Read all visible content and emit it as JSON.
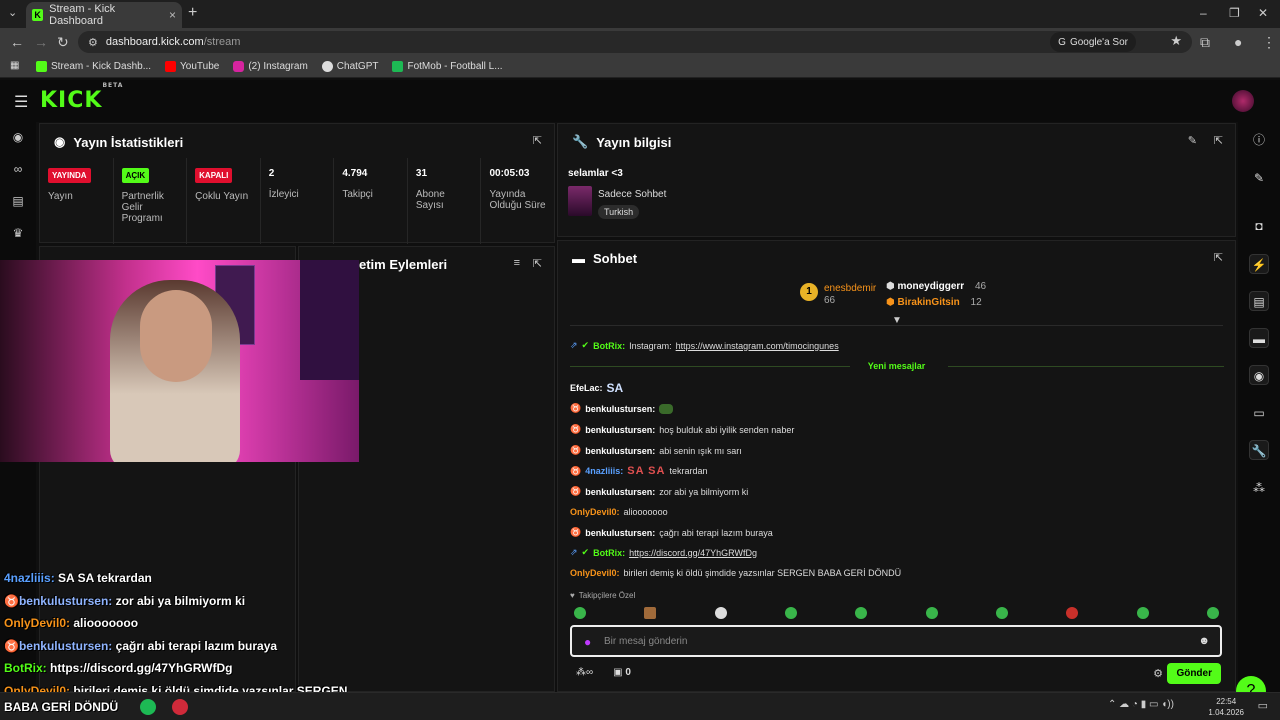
{
  "browser": {
    "tab_title": "Stream - Kick Dashboard",
    "url_host": "dashboard.kick.com",
    "url_path": "/stream",
    "google_label": "Google'a Sor",
    "bookmarks": [
      "Stream - Kick Dashb...",
      "YouTube",
      "(2) Instagram",
      "ChatGPT",
      "FotMob - Football L..."
    ]
  },
  "header": {
    "logo": "KICK",
    "logo_badge": "BETA"
  },
  "stats_panel": {
    "title": "Yayın İstatistikleri",
    "items": [
      {
        "badge": "YAYINDA",
        "label": "Yayın"
      },
      {
        "badge": "AÇIK",
        "label": "Partnerlik Gelir Programı"
      },
      {
        "badge": "KAPALI",
        "label": "Çoklu Yayın"
      },
      {
        "value": "2",
        "label": "İzleyici"
      },
      {
        "value": "4.794",
        "label": "Takipçi"
      },
      {
        "value": "31",
        "label": "Abone Sayısı"
      },
      {
        "value": "00:05:03",
        "label": "Yayında Olduğu Süre"
      }
    ]
  },
  "actions_panel": {
    "title": "etim Eylemleri"
  },
  "info_panel": {
    "title": "Yayın bilgisi",
    "stream_title": "selamlar <3",
    "category": "Sadece Sohbet",
    "tag": "Turkish"
  },
  "chat_panel": {
    "title": "Sohbet",
    "leaders": [
      {
        "rank": "1",
        "name": "enesbdemir",
        "count": "66"
      },
      {
        "name": "moneydiggerr",
        "count": "46"
      },
      {
        "name": "BirakinGitsin",
        "count": "12"
      }
    ],
    "new_messages_label": "Yeni mesajlar",
    "messages": [
      {
        "user": "BotRix:",
        "text": "Instagram:",
        "link": "https://www.instagram.com/timocingunes"
      },
      {
        "user": "EfeLac:",
        "text": "SA"
      },
      {
        "user": "benkulustursen:",
        "text": ""
      },
      {
        "user": "benkulustursen:",
        "text": "hoş bulduk abi iyilik senden naber"
      },
      {
        "user": "benkulustursen:",
        "text": "abi senin ışık mı sarı"
      },
      {
        "user": "4nazliiis:",
        "sasa": "SA SA",
        "text": "tekrardan"
      },
      {
        "user": "benkulustursen:",
        "text": "zor abi ya bilmiyorm ki"
      },
      {
        "user": "OnlyDevil0:",
        "text": "aliooooooo"
      },
      {
        "user": "benkulustursen:",
        "text": "çağrı abi terapi lazım buraya"
      },
      {
        "user": "BotRix:",
        "link": "https://discord.gg/47YhGRWfDg"
      },
      {
        "user": "OnlyDevil0:",
        "text": "birileri demiş ki öldü şimdide yazsınlar SERGEN BABA GERİ DÖNDÜ"
      }
    ],
    "followers_only": "Takipçilere Özel",
    "input_placeholder": "Bir mesaj gönderin",
    "points": "0",
    "send_label": "Gönder"
  },
  "overlay_chat": [
    {
      "user": "4nazliiis:",
      "text": "SA SA tekrardan"
    },
    {
      "user": "benkulustursen:",
      "text": "zor abi ya bilmiyorm ki"
    },
    {
      "user": "OnlyDevil0:",
      "text": "aliooooooo"
    },
    {
      "user": "benkulustursen:",
      "text": "çağrı abi terapi lazım buraya"
    },
    {
      "user": "BotRix:",
      "text": "https://discord.gg/47YhGRWfDg"
    },
    {
      "user": "OnlyDevil0:",
      "text": "birileri demiş ki öldü şimdide yazsınlar SERGEN"
    },
    {
      "user": "",
      "text": "BABA GERİ DÖNDÜ"
    }
  ],
  "taskbar": {
    "time": "22:54",
    "date": "1.04.2026"
  },
  "colors": {
    "kick_green": "#53fc18",
    "live_red": "#e00f2e",
    "bg": "#0f0f0f"
  }
}
